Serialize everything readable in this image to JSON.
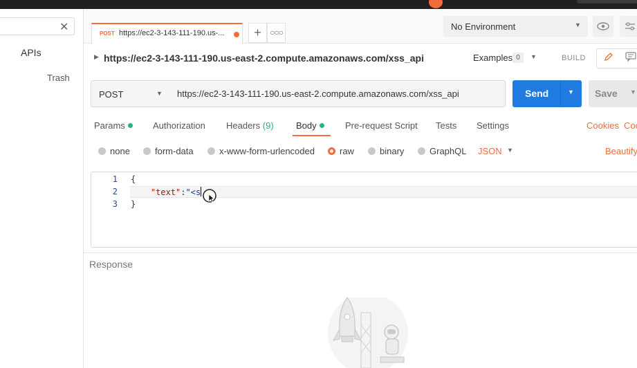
{
  "sidebar": {
    "search_clear_icon": "close-icon",
    "apis_label": "APIs",
    "trash_label": "Trash"
  },
  "tabs": [
    {
      "method": "POST",
      "label": "https://ec2-3-143-111-190.us-...",
      "unsaved": true
    }
  ],
  "environment": {
    "selected": "No Environment"
  },
  "request": {
    "title": "https://ec2-3-143-111-190.us-east-2.compute.amazonaws.com/xss_api",
    "examples_label": "Examples",
    "examples_count": "0",
    "build_label": "BUILD",
    "method": "POST",
    "url": "https://ec2-3-143-111-190.us-east-2.compute.amazonaws.com/xss_api",
    "send_label": "Send",
    "save_label": "Save"
  },
  "request_tabs": {
    "params": "Params",
    "authorization": "Authorization",
    "headers": "Headers",
    "headers_count": "(9)",
    "body": "Body",
    "prerequest": "Pre-request Script",
    "tests": "Tests",
    "settings": "Settings",
    "cookies": "Cookies",
    "code": "Coc"
  },
  "body_options": {
    "none": "none",
    "form_data": "form-data",
    "urlencoded": "x-www-form-urlencoded",
    "raw": "raw",
    "binary": "binary",
    "graphql": "GraphQL",
    "format": "JSON",
    "beautify": "Beautify",
    "selected": "raw"
  },
  "editor": {
    "line_numbers": [
      "1",
      "2",
      "3"
    ],
    "line1": "{",
    "line2_key": "\"text\"",
    "line2_colon": ":",
    "line2_value": "\"<s",
    "line3": "}"
  },
  "response": {
    "label": "Response"
  },
  "colors": {
    "accent": "#f26b3a",
    "send": "#1f7be0",
    "status_green": "#26b47f"
  }
}
